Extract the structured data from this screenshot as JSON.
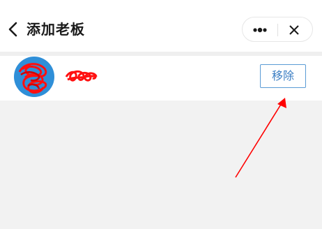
{
  "header": {
    "title": "添加老板",
    "back_icon": "chevron-left-icon",
    "more_icon": "more-dots-icon",
    "close_icon": "close-icon"
  },
  "list": {
    "items": [
      {
        "avatar_icon": "user-avatar",
        "name": "",
        "action_label": "移除"
      }
    ]
  },
  "colors": {
    "accent": "#3d7fc4",
    "avatar_bg": "#2f8fd8",
    "annotation": "#ff0000"
  }
}
